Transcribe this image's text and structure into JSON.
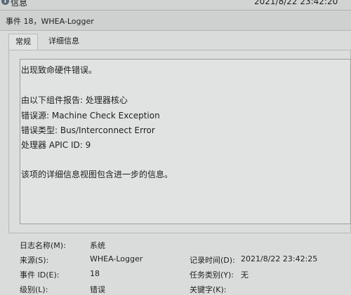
{
  "window": {
    "title": "信息",
    "time": "2021/8/22 23:42:20"
  },
  "event_header": "事件 18，WHEA-Logger",
  "tabs": [
    "常规",
    "详细信息"
  ],
  "description": [
    "出现致命硬件错误。",
    "由以下组件报告: 处理器核心",
    "错误源: Machine Check Exception",
    "错误类型: Bus/Interconnect Error",
    "处理器 APIC ID: 9",
    "该项的详细信息视图包含进一步的信息。"
  ],
  "properties": {
    "log_name_label": "日志名称(M):",
    "log_name_value": "系统",
    "source_label": "来源(S):",
    "source_value": "WHEA-Logger",
    "logged_label": "记录时间(D):",
    "logged_value": "2021/8/22 23:42:25",
    "event_id_label": "事件 ID(E):",
    "event_id_value": "18",
    "task_category_label": "任务类别(Y):",
    "task_category_value": "无",
    "level_label": "级别(L):",
    "level_value": "错误",
    "keywords_label": "关键字(K):"
  }
}
